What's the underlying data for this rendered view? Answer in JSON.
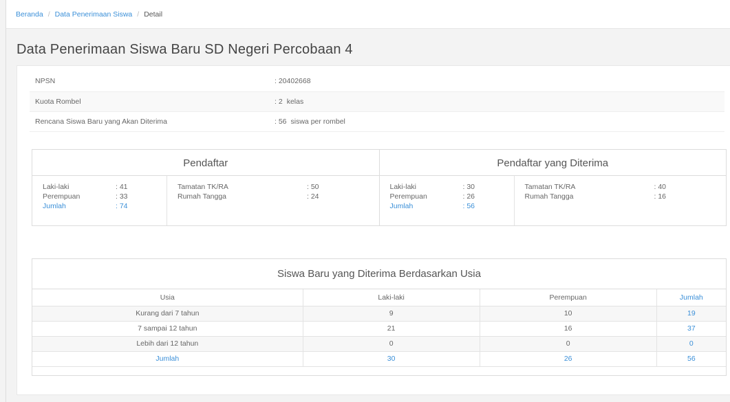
{
  "breadcrumb": {
    "home": "Beranda",
    "section": "Data Penerimaan Siswa",
    "current": "Detail",
    "separator": "/"
  },
  "page_title": "Data Penerimaan Siswa Baru SD Negeri Percobaan 4",
  "info": {
    "npsn_label": "NPSN",
    "npsn_value": ": 20402668",
    "kuota_label": "Kuota Rombel",
    "kuota_value": ": 2",
    "kuota_unit": "kelas",
    "rencana_label": "Rencana Siswa Baru yang Akan Diterima",
    "rencana_value": ": 56",
    "rencana_unit": "siswa per rombel"
  },
  "pendaftar": {
    "title": "Pendaftar",
    "laki_label": "Laki-laki",
    "laki_value": ": 41",
    "perempuan_label": "Perempuan",
    "perempuan_value": ": 33",
    "jumlah_label": "Jumlah",
    "jumlah_value": ": 74",
    "tamatan_label": "Tamatan TK/RA",
    "tamatan_value": ": 50",
    "rumah_label": "Rumah Tangga",
    "rumah_value": ": 24"
  },
  "diterima": {
    "title": "Pendaftar yang Diterima",
    "laki_label": "Laki-laki",
    "laki_value": ": 30",
    "perempuan_label": "Perempuan",
    "perempuan_value": ": 26",
    "jumlah_label": "Jumlah",
    "jumlah_value": ": 56",
    "tamatan_label": "Tamatan TK/RA",
    "tamatan_value": ": 40",
    "rumah_label": "Rumah Tangga",
    "rumah_value": ": 16"
  },
  "age_table": {
    "title": "Siswa Baru yang Diterima Berdasarkan Usia",
    "headers": [
      "Usia",
      "Laki-laki",
      "Perempuan",
      "Jumlah"
    ],
    "rows": [
      [
        "Kurang dari 7 tahun",
        "9",
        "10",
        "19"
      ],
      [
        "7 sampai 12 tahun",
        "21",
        "16",
        "37"
      ],
      [
        "Lebih dari 12 tahun",
        "0",
        "0",
        "0"
      ],
      [
        "Jumlah",
        "30",
        "26",
        "56"
      ]
    ]
  },
  "colors": {
    "accent": "#3a8fd8",
    "text": "#555555",
    "background": "#f3f3f3"
  }
}
